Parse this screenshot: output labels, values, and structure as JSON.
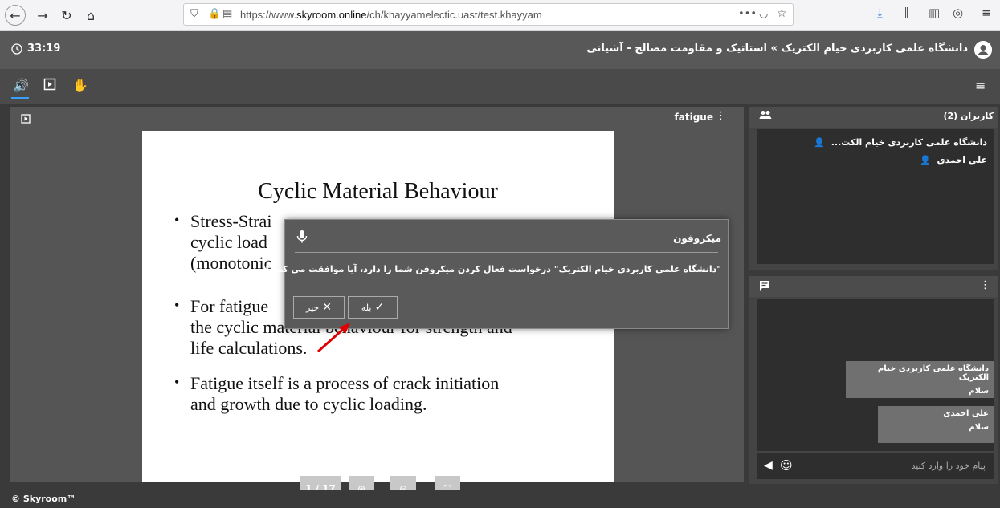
{
  "browser": {
    "url_pre": "https://www.",
    "url_domain": "skyroom.online",
    "url_post": "/ch/khayyamelectic.uast/test.khayyam",
    "more_label": "•••"
  },
  "header": {
    "timer": "33:19",
    "title": "دانشگاه علمی کاربردی خیام الکتریک » استاتیک و مقاومت مصالح - آشیانی"
  },
  "presentation": {
    "name": "fatigue",
    "slide_title": "Cyclic Material Behaviour",
    "bullets": [
      "Stress-Strain curves of most materials under cyclic loading differ from those for static (monotonic) loading.",
      "For fatigue studies it is necessary to know the cyclic material behaviour for strength and life calculations.",
      "Fatigue itself is a process of crack initiation and growth due to cyclic loading."
    ],
    "bullet1_lines": [
      "Stress-Strai",
      "cyclic load",
      "(monotonic"
    ],
    "bullet2_lines": [
      "For fatigue",
      "the cyclic material behaviour for strength and",
      "life calculations."
    ],
    "bullet3_lines": [
      "Fatigue itself is a process of crack initiation",
      "and growth due to cyclic loading."
    ],
    "page": "1 / 17"
  },
  "dialog": {
    "title": "میکروفون",
    "message": "\"دانشگاه علمی کاربردی خیام الکتریک\" درخواست فعال کردن میکروفن شما را دارد، آیا موافقت می کنید؟",
    "yes_label": "بله",
    "no_label": "خیر"
  },
  "users": {
    "title": "کاربران (2)",
    "list": [
      {
        "name": "دانشگاه علمی کاربردی خیام الکت...",
        "color": "#3aa0ff"
      },
      {
        "name": "علی احمدی",
        "color": "#f2c200"
      }
    ]
  },
  "chat": {
    "messages": [
      {
        "sender": "دانشگاه علمی کاربردی خیام الکتریک",
        "text": "سلام"
      },
      {
        "sender": "علی احمدی",
        "text": "سلام"
      }
    ],
    "placeholder": "پیام خود را وارد کنید"
  },
  "footer": {
    "text": "© Skyroom™"
  },
  "colors": {
    "accent": "#3aa0ff",
    "arrow": "#e00000"
  }
}
